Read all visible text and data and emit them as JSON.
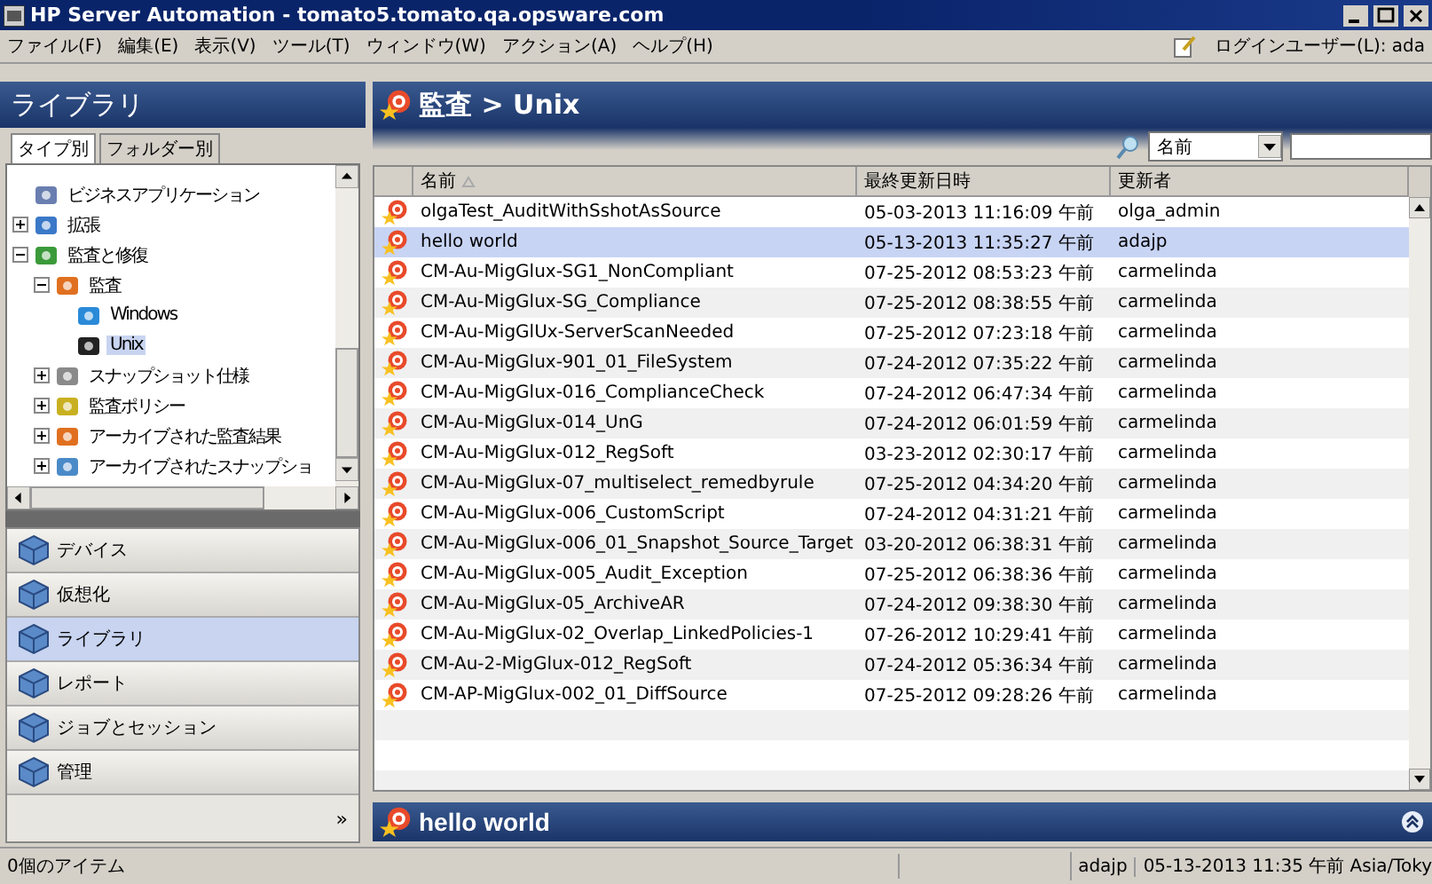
{
  "window": {
    "title": "HP Server Automation - tomato5.tomato.qa.opsware.com"
  },
  "menu": [
    "ファイル(F)",
    "編集(E)",
    "表示(V)",
    "ツール(T)",
    "ウィンドウ(W)",
    "アクション(A)",
    "ヘルプ(H)"
  ],
  "login": "ログインユーザー(L): ada",
  "sidebar": {
    "title": "ライブラリ",
    "tabs": [
      {
        "label": "タイプ別",
        "selected": true
      },
      {
        "label": "フォルダー別",
        "selected": false
      }
    ],
    "tree": [
      {
        "label": "ビジネスアプリケーション",
        "kind": "app",
        "selected": false
      },
      {
        "label": "拡張",
        "kind": "ext",
        "expanded": false,
        "selected": false
      },
      {
        "label": "監査と修復",
        "kind": "check",
        "expanded": true,
        "selected": false,
        "children": [
          {
            "label": "監査",
            "kind": "audit",
            "expanded": true,
            "selected": false,
            "children": [
              {
                "label": "Windows",
                "kind": "windows",
                "selected": false
              },
              {
                "label": "Unix",
                "kind": "unix",
                "selected": true
              }
            ]
          },
          {
            "label": "スナップショット仕様",
            "kind": "camera",
            "expanded": false,
            "selected": false
          },
          {
            "label": "監査ポリシー",
            "kind": "policy",
            "expanded": false,
            "selected": false
          },
          {
            "label": "アーカイブされた監査結果",
            "kind": "audit",
            "expanded": false,
            "selected": false
          },
          {
            "label": "アーカイブされたスナップショ",
            "kind": "archive",
            "expanded": false,
            "selected": false
          }
        ]
      }
    ],
    "nav": [
      {
        "label": "デバイス",
        "selected": false
      },
      {
        "label": "仮想化",
        "selected": false
      },
      {
        "label": "ライブラリ",
        "selected": true
      },
      {
        "label": "レポート",
        "selected": false
      },
      {
        "label": "ジョブとセッション",
        "selected": false
      },
      {
        "label": "管理",
        "selected": false
      }
    ],
    "more": "»"
  },
  "main": {
    "title": "監査 > Unix",
    "search": {
      "field": "名前"
    },
    "table": {
      "columns": [
        "名前",
        "最終更新日時",
        "更新者"
      ],
      "rows": [
        {
          "name": "olgaTest_AuditWithSshotAsSource",
          "modified": "05-03-2013 11:16:09 午前",
          "by": "olga_admin",
          "selected": false
        },
        {
          "name": "hello world",
          "modified": "05-13-2013 11:35:27 午前",
          "by": "adajp",
          "selected": true
        },
        {
          "name": "CM-Au-MigGlux-SG1_NonCompliant",
          "modified": "07-25-2012 08:53:23 午前",
          "by": "carmelinda",
          "selected": false
        },
        {
          "name": "CM-Au-MigGlux-SG_Compliance",
          "modified": "07-25-2012 08:38:55 午前",
          "by": "carmelinda",
          "selected": false
        },
        {
          "name": "CM-Au-MigGlUx-ServerScanNeeded",
          "modified": "07-25-2012 07:23:18 午前",
          "by": "carmelinda",
          "selected": false
        },
        {
          "name": "CM-Au-MigGlux-901_01_FileSystem",
          "modified": "07-24-2012 07:35:22 午前",
          "by": "carmelinda",
          "selected": false
        },
        {
          "name": "CM-Au-MigGlux-016_ComplianceCheck",
          "modified": "07-24-2012 06:47:34 午前",
          "by": "carmelinda",
          "selected": false
        },
        {
          "name": "CM-Au-MigGlux-014_UnG",
          "modified": "07-24-2012 06:01:59 午前",
          "by": "carmelinda",
          "selected": false
        },
        {
          "name": "CM-Au-MigGlux-012_RegSoft",
          "modified": "03-23-2012 02:30:17 午前",
          "by": "carmelinda",
          "selected": false
        },
        {
          "name": "CM-Au-MigGlux-07_multiselect_remedbyrule",
          "modified": "07-25-2012 04:34:20 午前",
          "by": "carmelinda",
          "selected": false
        },
        {
          "name": "CM-Au-MigGlux-006_CustomScript",
          "modified": "07-24-2012 04:31:21 午前",
          "by": "carmelinda",
          "selected": false
        },
        {
          "name": "CM-Au-MigGlux-006_01_Snapshot_Source_Target",
          "modified": "03-20-2012 06:38:31 午前",
          "by": "carmelinda",
          "selected": false
        },
        {
          "name": "CM-Au-MigGlux-005_Audit_Exception",
          "modified": "07-25-2012 06:38:36 午前",
          "by": "carmelinda",
          "selected": false
        },
        {
          "name": "CM-Au-MigGlux-05_ArchiveAR",
          "modified": "07-24-2012 09:38:30 午前",
          "by": "carmelinda",
          "selected": false
        },
        {
          "name": "CM-Au-MigGlux-02_Overlap_LinkedPolicies-1",
          "modified": "07-26-2012 10:29:41 午前",
          "by": "carmelinda",
          "selected": false
        },
        {
          "name": "CM-Au-2-MigGlux-012_RegSoft",
          "modified": "07-24-2012 05:36:34 午前",
          "by": "carmelinda",
          "selected": false
        },
        {
          "name": "CM-AP-MigGlux-002_01_DiffSource",
          "modified": "07-25-2012 09:28:26 午前",
          "by": "carmelinda",
          "selected": false
        }
      ]
    },
    "detail_title": "hello world"
  },
  "status_bar": {
    "left": "0個のアイテム",
    "user": "adajp",
    "time": "05-13-2013 11:35 午前 Asia/Toky"
  }
}
